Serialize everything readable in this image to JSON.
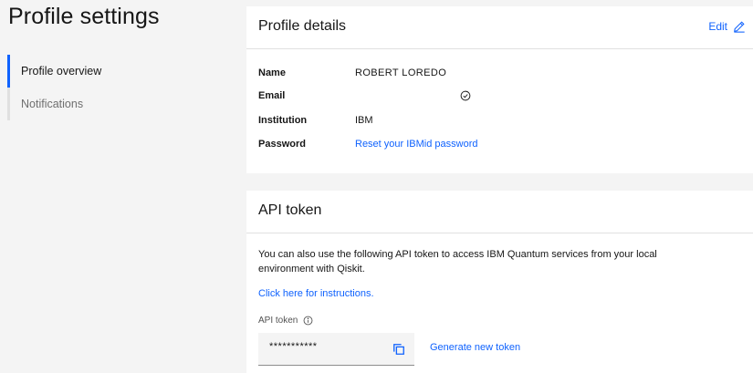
{
  "page": {
    "title": "Profile settings"
  },
  "sidebar": {
    "items": [
      {
        "label": "Profile overview",
        "active": true
      },
      {
        "label": "Notifications",
        "active": false
      }
    ]
  },
  "details": {
    "title": "Profile details",
    "edit_label": "Edit",
    "edit_icon": "pencil-icon",
    "rows": [
      {
        "label": "Name",
        "value": "ROBERT LOREDO"
      },
      {
        "label": "Email",
        "value": "",
        "icon": "check-circle-icon"
      },
      {
        "label": "Institution",
        "value": "IBM"
      },
      {
        "label": "Password",
        "value": "Reset your IBMid password"
      }
    ]
  },
  "api": {
    "title": "API token",
    "description": "You can also use the following API token to access IBM Quantum services from your local environment with Qiskit.",
    "instructions_link": "Click here for instructions.",
    "token_label": "API token",
    "token_info_icon": "info-icon",
    "token_value": "***********",
    "copy_icon": "copy-icon",
    "generate_label": "Generate new token"
  },
  "colors": {
    "accent": "#0f62fe",
    "background": "#f4f4f4",
    "card": "#ffffff"
  }
}
